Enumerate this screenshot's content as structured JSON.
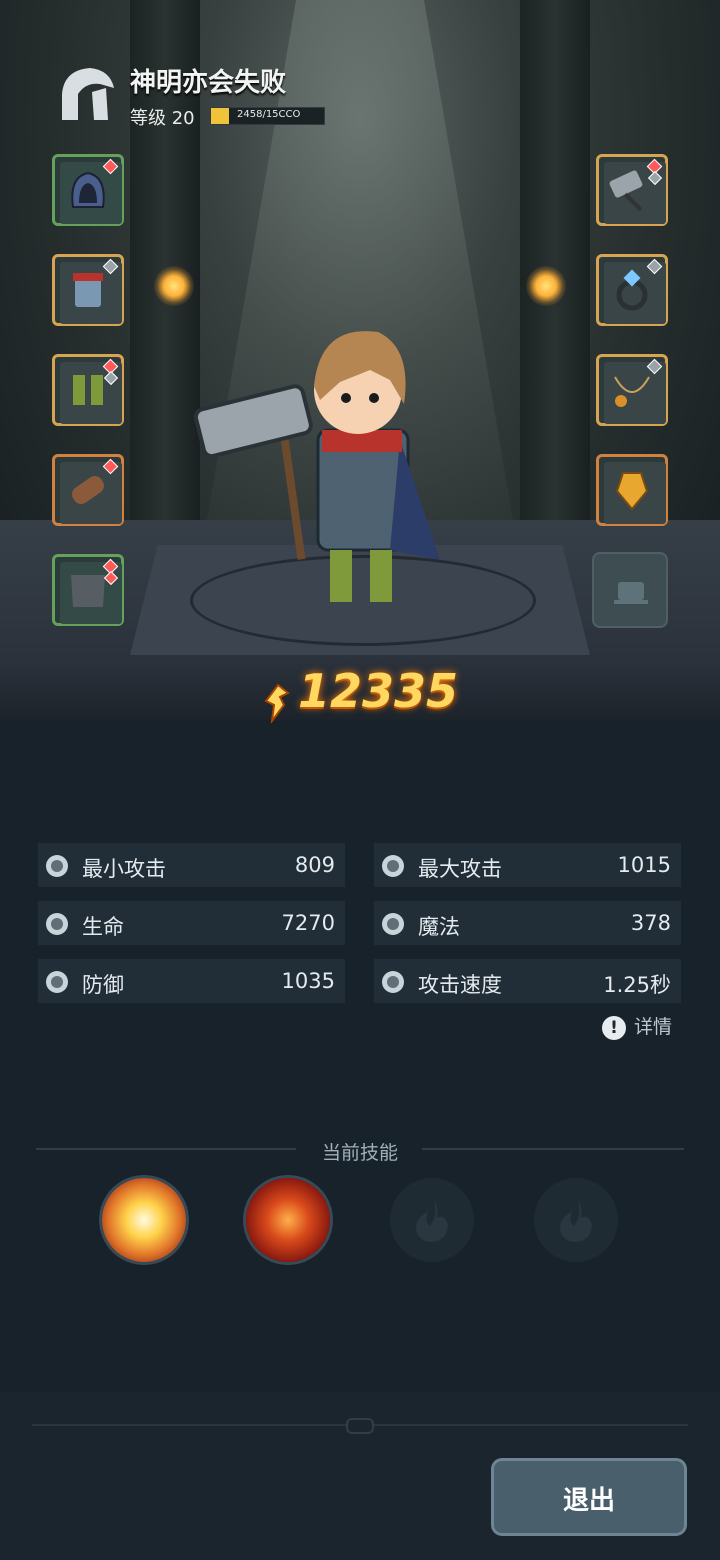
{
  "player": {
    "name": "神明亦会失败",
    "level_text": "等级 20",
    "xp_text": "2458/15CCO",
    "xp_progress": 0.16
  },
  "power": {
    "value": "12335"
  },
  "equipment": {
    "left": [
      "helmet",
      "chest-armor",
      "boots",
      "bracer",
      "pants"
    ],
    "right": [
      "hammer-weapon",
      "ring",
      "necklace",
      "amulet",
      "empty"
    ]
  },
  "stats": [
    {
      "label": "最小攻击",
      "value": "809",
      "icon": "sword-icon"
    },
    {
      "label": "最大攻击",
      "value": "1015",
      "icon": "sword-icon"
    },
    {
      "label": "生命",
      "value": "7270",
      "icon": "heart-icon"
    },
    {
      "label": "魔法",
      "value": "378",
      "icon": "magic-icon"
    },
    {
      "label": "防御",
      "value": "1035",
      "icon": "shield-icon"
    },
    {
      "label": "攻击速度",
      "value": "1.25秒",
      "icon": "speed-icon"
    }
  ],
  "detail_label": "详情",
  "skills": {
    "title": "当前技能",
    "slots": [
      "explosion-skill",
      "fire-vortex-skill",
      "locked",
      "locked"
    ]
  },
  "exit_label": "退出",
  "colors": {
    "gold": "#ffd861",
    "xp": "#f0c43a",
    "panel": "#212d37",
    "bg": "#18222b"
  }
}
